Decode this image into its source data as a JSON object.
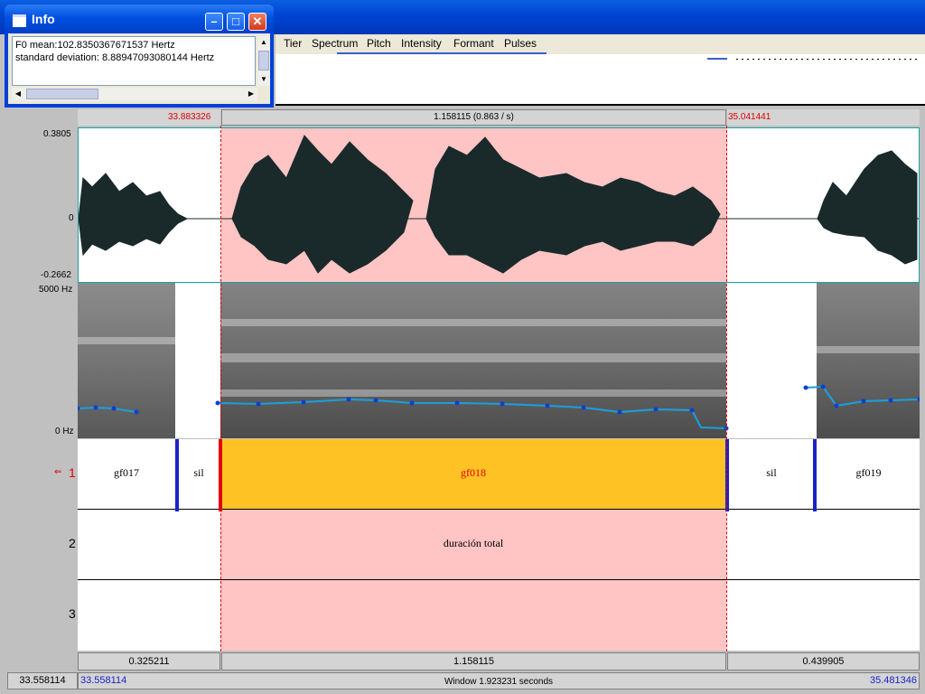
{
  "menu": [
    "Tier",
    "Spectrum",
    "Pitch",
    "Intensity",
    "Formant",
    "Pulses"
  ],
  "info_window": {
    "title": "Info",
    "lines": [
      "F0 mean:102.8350367671537 Hertz",
      "standard deviation: 8.88947093080144 Hertz"
    ]
  },
  "time_header": {
    "sel_start": "33.883326",
    "sel_end": "35.041441",
    "sel_duration": "1.158115 (0.863 / s)"
  },
  "waveform": {
    "y_max": "0.3805",
    "y_zero": "0",
    "y_min": "-0.2662"
  },
  "spectrogram": {
    "f_max": "5000 Hz",
    "f_min": "0 Hz"
  },
  "tiers": [
    {
      "number": "1",
      "intervals": [
        {
          "label": "gf017",
          "selected": false
        },
        {
          "label": "sil",
          "selected": false
        },
        {
          "label": "gf018",
          "selected": true
        },
        {
          "label": "sil",
          "selected": false
        },
        {
          "label": "gf019",
          "selected": false
        }
      ]
    },
    {
      "number": "2",
      "intervals": [
        {
          "label": "duración total"
        }
      ]
    },
    {
      "number": "3",
      "intervals": []
    }
  ],
  "bottom_durations": [
    "0.325211",
    "1.158115",
    "0.439905"
  ],
  "status_bar": {
    "cursor_time": "33.558114",
    "window_start": "33.558114",
    "window_label": "Window 1.923231 seconds",
    "window_end": "35.481346"
  },
  "colors": {
    "selection": "#ffc4c4",
    "selected_interval": "#ffc225",
    "boundary": "#1a22c8",
    "pitch": "#1aa0e0"
  }
}
